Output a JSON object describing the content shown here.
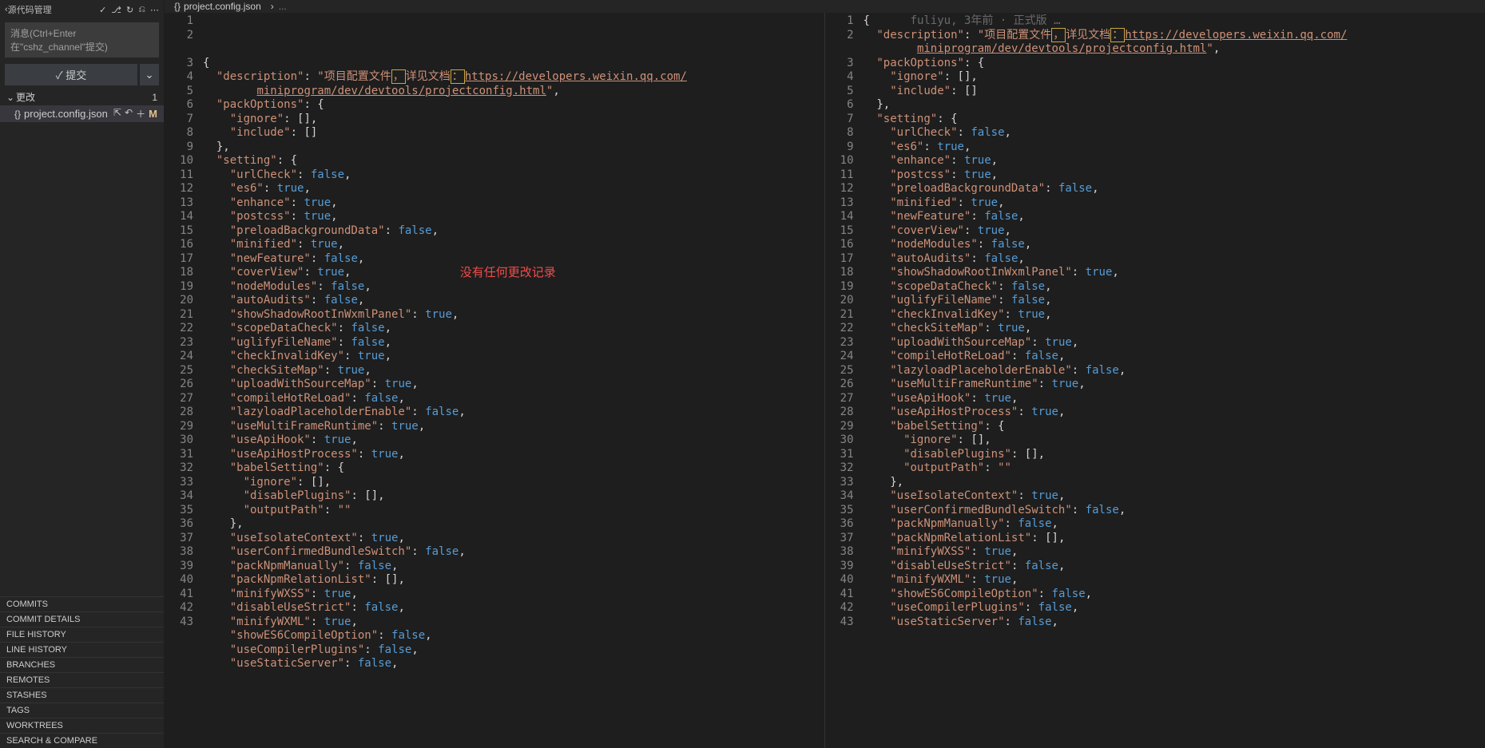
{
  "scm": {
    "title": "源代码管理",
    "icons": [
      "check-icon",
      "tree-icon",
      "refresh-icon",
      "commit-icon",
      "more-icon"
    ],
    "input_placeholder": "消息(Ctrl+Enter 在\"cshz_channel\"提交)",
    "commit_label": "✓ 提交",
    "dropdown_label": "⌄",
    "changes_label": "更改",
    "changes_count": "1",
    "file": {
      "name": "project.config.json",
      "status": "M",
      "actions": [
        "open-icon",
        "discard-icon",
        "stage-icon"
      ]
    }
  },
  "panels": [
    "COMMITS",
    "COMMIT DETAILS",
    "FILE HISTORY",
    "LINE HISTORY",
    "BRANCHES",
    "REMOTES",
    "STASHES",
    "TAGS",
    "WORKTREES",
    "SEARCH & COMPARE"
  ],
  "tab": {
    "filename": "project.config.json",
    "breadcrumb": "..."
  },
  "diff": {
    "no_change_msg": "没有任何更改记录",
    "blame_right": "fuliyu, 3年前 · 正式版 …",
    "desc_prefix": "项目配置文件",
    "desc_mid_a": "，",
    "desc_mid_b": "详见文档",
    "desc_mid_c": "：",
    "url_a": "https://developers.weixin.qq.com/",
    "url_b": "miniprogram/dev/devtools/projectconfig.html",
    "lines_code": [
      "{",
      "DESC",
      "DESC2",
      "  \"packOptions\": {",
      "    \"ignore\": [],",
      "    \"include\": []",
      "  },",
      "  \"setting\": {",
      "    \"urlCheck\": false,",
      "    \"es6\": true,",
      "    \"enhance\": true,",
      "    \"postcss\": true,",
      "    \"preloadBackgroundData\": false,",
      "    \"minified\": true,",
      "    \"newFeature\": false,",
      "    \"coverView\": true,",
      "    \"nodeModules\": false,",
      "    \"autoAudits\": false,",
      "    \"showShadowRootInWxmlPanel\": true,",
      "    \"scopeDataCheck\": false,",
      "    \"uglifyFileName\": false,",
      "    \"checkInvalidKey\": true,",
      "    \"checkSiteMap\": true,",
      "    \"uploadWithSourceMap\": true,",
      "    \"compileHotReLoad\": false,",
      "    \"lazyloadPlaceholderEnable\": false,",
      "    \"useMultiFrameRuntime\": true,",
      "    \"useApiHook\": true,",
      "    \"useApiHostProcess\": true,",
      "    \"babelSetting\": {",
      "      \"ignore\": [],",
      "      \"disablePlugins\": [],",
      "      \"outputPath\": \"\"",
      "    },",
      "    \"useIsolateContext\": true,",
      "    \"userConfirmedBundleSwitch\": false,",
      "    \"packNpmManually\": false,",
      "    \"packNpmRelationList\": [],",
      "    \"minifyWXSS\": true,",
      "    \"disableUseStrict\": false,",
      "    \"minifyWXML\": true,",
      "    \"showES6CompileOption\": false,",
      "    \"useCompilerPlugins\": false,",
      "    \"useStaticServer\": false,"
    ]
  }
}
